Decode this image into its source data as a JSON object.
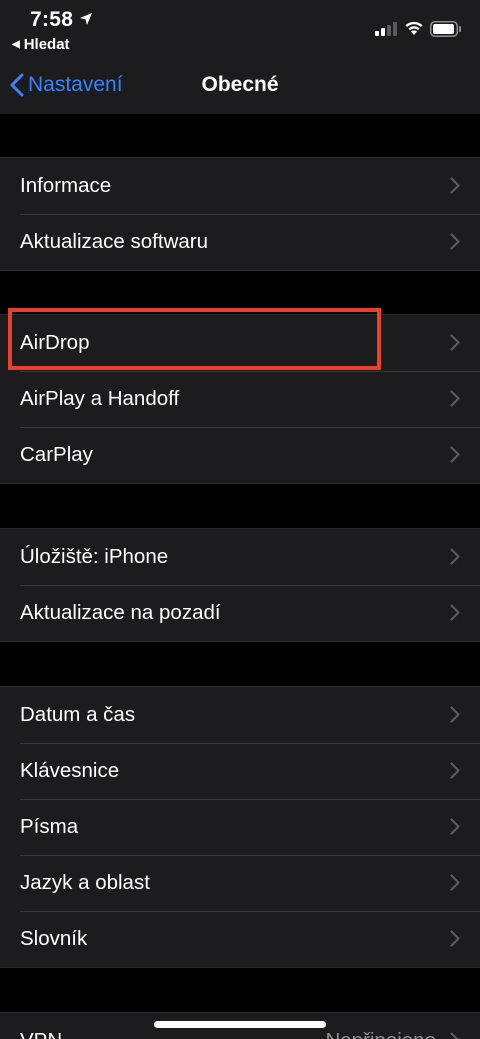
{
  "status": {
    "time": "7:58",
    "back_app_label": "Hledat"
  },
  "nav": {
    "back_label": "Nastavení",
    "title": "Obecné",
    "accent_color": "#3a82f7"
  },
  "groups": [
    {
      "rows": [
        {
          "label": "Informace"
        },
        {
          "label": "Aktualizace softwaru"
        }
      ]
    },
    {
      "rows": [
        {
          "label": "AirDrop"
        },
        {
          "label": "AirPlay a Handoff"
        },
        {
          "label": "CarPlay"
        }
      ]
    },
    {
      "rows": [
        {
          "label": "Úložiště: iPhone"
        },
        {
          "label": "Aktualizace na pozadí"
        }
      ]
    },
    {
      "rows": [
        {
          "label": "Datum a čas"
        },
        {
          "label": "Klávesnice"
        },
        {
          "label": "Písma"
        },
        {
          "label": "Jazyk a oblast"
        },
        {
          "label": "Slovník"
        }
      ]
    },
    {
      "rows": [
        {
          "label": "VPN",
          "value": "Nepřipojeno"
        }
      ]
    }
  ],
  "highlight_color": "#e8402a"
}
